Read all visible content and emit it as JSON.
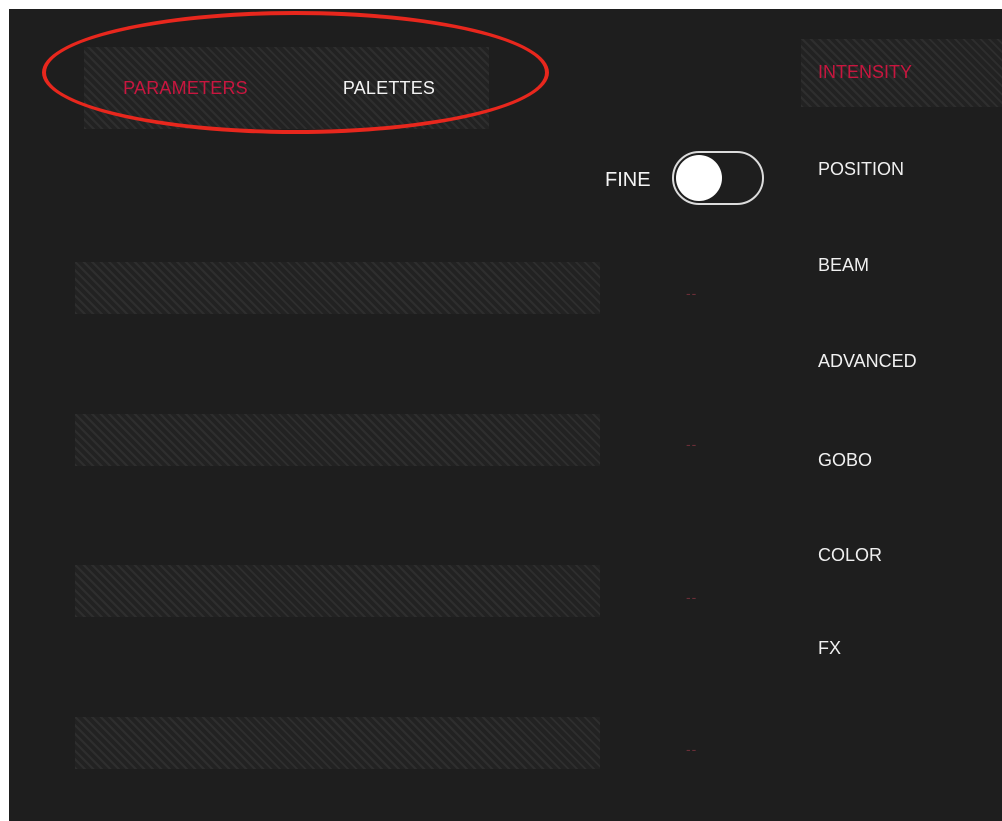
{
  "tabs": {
    "parameters": "PARAMETERS",
    "palettes": "PALETTES"
  },
  "fine": {
    "label": "FINE",
    "state": "on"
  },
  "categories": [
    "INTENSITY",
    "POSITION",
    "BEAM",
    "ADVANCED",
    "GOBO",
    "COLOR",
    "FX"
  ],
  "active_category": "INTENSITY",
  "parameters": [
    {
      "value": "--"
    },
    {
      "value": "--"
    },
    {
      "value": "--"
    },
    {
      "value": "--"
    }
  ],
  "colors": {
    "accent": "#c8163f",
    "background": "#1e1e1e",
    "annotation": "#e8271d"
  }
}
